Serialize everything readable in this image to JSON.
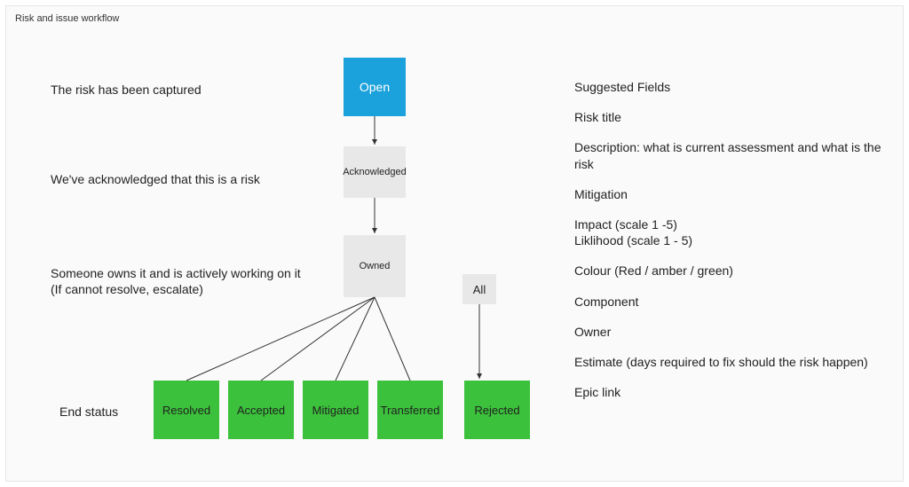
{
  "title": "Risk and issue workflow",
  "captions": {
    "open": "The risk has been captured",
    "acknowledged": "We've acknowledged that this is a risk",
    "owned_line1": "Someone owns it and is actively working on it",
    "owned_line2": "(If cannot resolve, escalate)",
    "end": "End status"
  },
  "nodes": {
    "open": "Open",
    "acknowledged": "Acknowledged",
    "owned": "Owned",
    "all": "All",
    "resolved": "Resolved",
    "accepted": "Accepted",
    "mitigated": "Mitigated",
    "transferred": "Transferred",
    "rejected": "Rejected"
  },
  "side": {
    "heading": "Suggested Fields",
    "risk_title": "Risk title",
    "description": "Description: what is current assessment and what is the risk",
    "mitigation": "Mitigation",
    "impact": "Impact (scale 1 -5)",
    "likelihood": "Liklihood (scale 1 - 5)",
    "colour": "Colour (Red / amber / green)",
    "component": "Component",
    "owner": "Owner",
    "estimate": "Estimate (days required to fix should the risk happen)",
    "epic_link": "Epic link"
  }
}
